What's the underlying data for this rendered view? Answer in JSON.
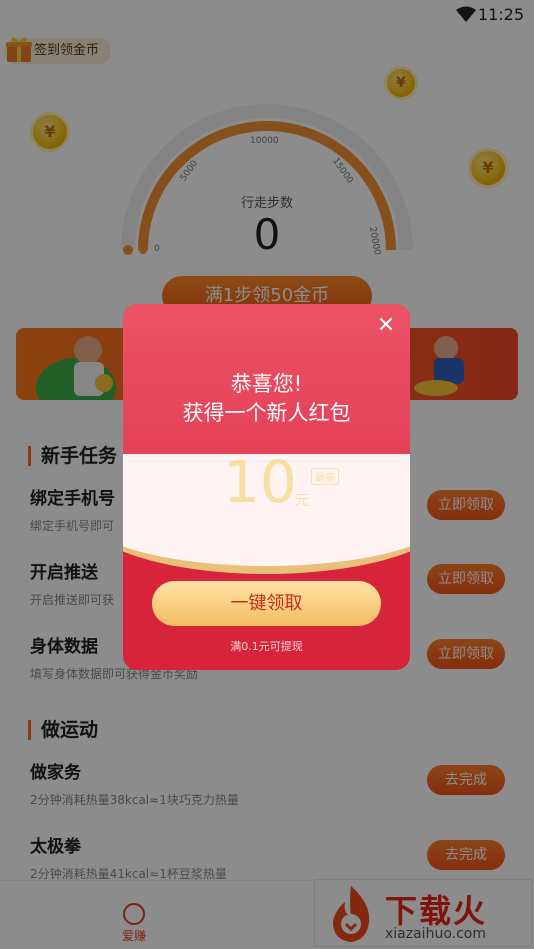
{
  "status_bar": {
    "time": "11:25"
  },
  "header": {
    "checkin_label": "签到领金币"
  },
  "gauge": {
    "label": "行走步数",
    "value": "0",
    "ticks": [
      "0",
      "5000",
      "10000",
      "15000",
      "20000"
    ]
  },
  "step_button": {
    "label": "满1步领50金币"
  },
  "newbie_tasks": {
    "title": "新手任务",
    "items": [
      {
        "name": "绑定手机号",
        "desc": "绑定手机号即可",
        "button": "立即领取"
      },
      {
        "name": "开启推送",
        "desc": "开启推送即可获",
        "button": "立即领取"
      },
      {
        "name": "身体数据",
        "desc": "填写身体数据即可获得金币奖励",
        "button": "立即领取"
      }
    ]
  },
  "exercise_tasks": {
    "title": "做运动",
    "items": [
      {
        "name": "做家务",
        "desc": "2分钟消耗热量38kcal≈1块巧克力热量",
        "button": "去完成"
      },
      {
        "name": "太极拳",
        "desc": "2分钟消耗热量41kcal≈1杯豆浆热量",
        "button": "去完成"
      }
    ]
  },
  "bottom_nav": {
    "item_label": "爱赚"
  },
  "watermark": {
    "brand": "下载火",
    "url": "xiazaihuo.com"
  },
  "modal": {
    "title_line1": "恭喜您!",
    "title_line2": "获得一个新人红包",
    "amount": "10",
    "unit": "元",
    "tag": "最高",
    "claim_button": "一键领取",
    "note": "满0.1元可提现"
  }
}
